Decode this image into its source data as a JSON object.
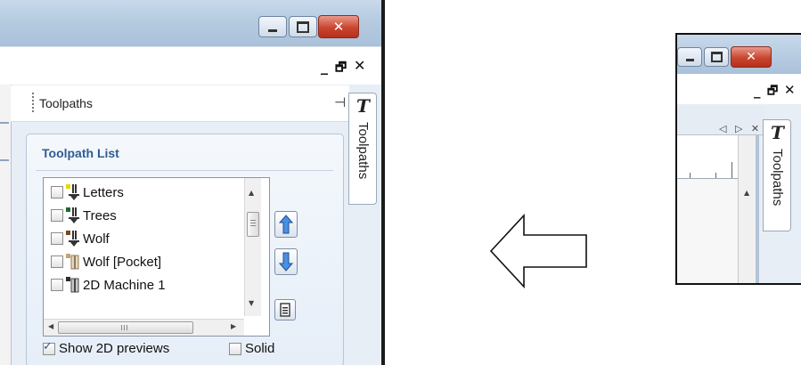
{
  "large_window": {
    "mdi_controls": {
      "minimize": "_",
      "restore": "🗗",
      "close": "✕"
    },
    "panel": {
      "title": "Toolpaths",
      "pin_glyph": "⊣",
      "side_tab": {
        "icon_glyph": "T",
        "label": "Toolpaths"
      },
      "group_title": "Toolpath List",
      "items": [
        {
          "label": "Letters",
          "checked": false,
          "icon": "drill-down-icon",
          "color": "#e8d800"
        },
        {
          "label": "Trees",
          "checked": false,
          "icon": "drill-down-icon",
          "color": "#1e6b2a"
        },
        {
          "label": "Wolf",
          "checked": false,
          "icon": "drill-down-icon",
          "color": "#7a4a1c"
        },
        {
          "label": "Wolf [Pocket]",
          "checked": false,
          "icon": "pocket-icon",
          "color": "#c9a36a"
        },
        {
          "label": "2D Machine 1",
          "checked": false,
          "icon": "pocket-icon",
          "color": "#2b2b2b"
        }
      ],
      "scroll_glyphs": {
        "up": "▲",
        "down": "▼",
        "left": "◀",
        "right": "▶",
        "grip": "III"
      },
      "show_2d_previews": {
        "label": "Show 2D previews",
        "checked": true
      },
      "solid": {
        "label": "Solid",
        "checked": false
      }
    }
  },
  "small_window": {
    "mdi_controls": {
      "minimize": "_",
      "restore": "🗗",
      "close": "✕"
    },
    "doc_nav": "◁ ▷ ✕",
    "side_tab": {
      "icon_glyph": "T",
      "label": "Toolpaths"
    }
  },
  "colors": {
    "accent_blue": "#2f5c94",
    "close_red": "#c9452f",
    "arrow_blue": "#3a7bd5"
  }
}
